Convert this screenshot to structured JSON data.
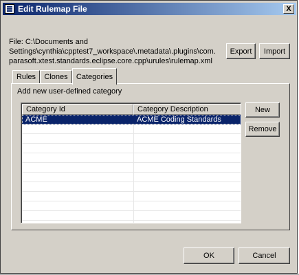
{
  "window": {
    "title": "Edit Rulemap File",
    "close_label": "X"
  },
  "file": {
    "path_text": "File: C:\\Documents and\nSettings\\cynthia\\cpptest7_workspace\\.metadata\\.plugins\\com.\nparasoft.xtest.standards.eclipse.core.cpp\\urules\\rulemap.xml"
  },
  "buttons": {
    "export": "Export",
    "import": "Import",
    "new": "New",
    "remove": "Remove",
    "ok": "OK",
    "cancel": "Cancel"
  },
  "tabs": [
    {
      "label": "Rules",
      "selected": false
    },
    {
      "label": "Clones",
      "selected": false
    },
    {
      "label": "Categories",
      "selected": true
    }
  ],
  "panel": {
    "label": "Add new user-defined category"
  },
  "table": {
    "columns": [
      "Category Id",
      "Category Description"
    ],
    "rows": [
      {
        "id": "ACME",
        "description": "ACME Coding Standards",
        "selected": true
      }
    ]
  },
  "colors": {
    "dialog_bg": "#d4d0c8",
    "titlebar_start": "#0a246a",
    "titlebar_end": "#a6caf0",
    "selection": "#0a246a"
  }
}
